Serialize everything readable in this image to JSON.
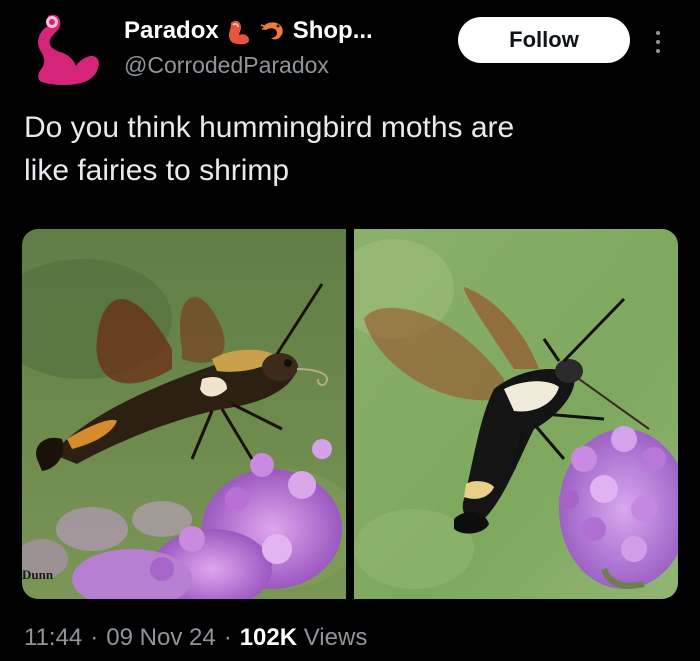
{
  "author": {
    "display_name": "Paradox",
    "name_suffix": "Shop...",
    "handle": "@CorrodedParadox",
    "avatar_icon": "pink-silhouette-avatar",
    "name_emojis": [
      "flexed-arm-emoji",
      "shrimp-emoji"
    ]
  },
  "follow_button": {
    "label": "Follow"
  },
  "more_menu": {
    "icon": "vertical-ellipsis-icon"
  },
  "tweet": {
    "text_line1": "Do you think hummingbird moths are",
    "text_line2": "like fairies to shrimp"
  },
  "media": {
    "photos": [
      {
        "subject": "hummingbird moth hovering near purple verbena",
        "credit": "Dunn"
      },
      {
        "subject": "hummingbird moth feeding on purple verbena"
      }
    ]
  },
  "meta": {
    "time": "11:44",
    "separator": "·",
    "date": "09 Nov 24",
    "views_count": "102K",
    "views_label": "Views"
  },
  "colors": {
    "background": "#000000",
    "text": "#e8eaed",
    "secondary_text": "#8f959b",
    "follow_bg": "#ffffff",
    "avatar_pink": "#d6247a"
  }
}
